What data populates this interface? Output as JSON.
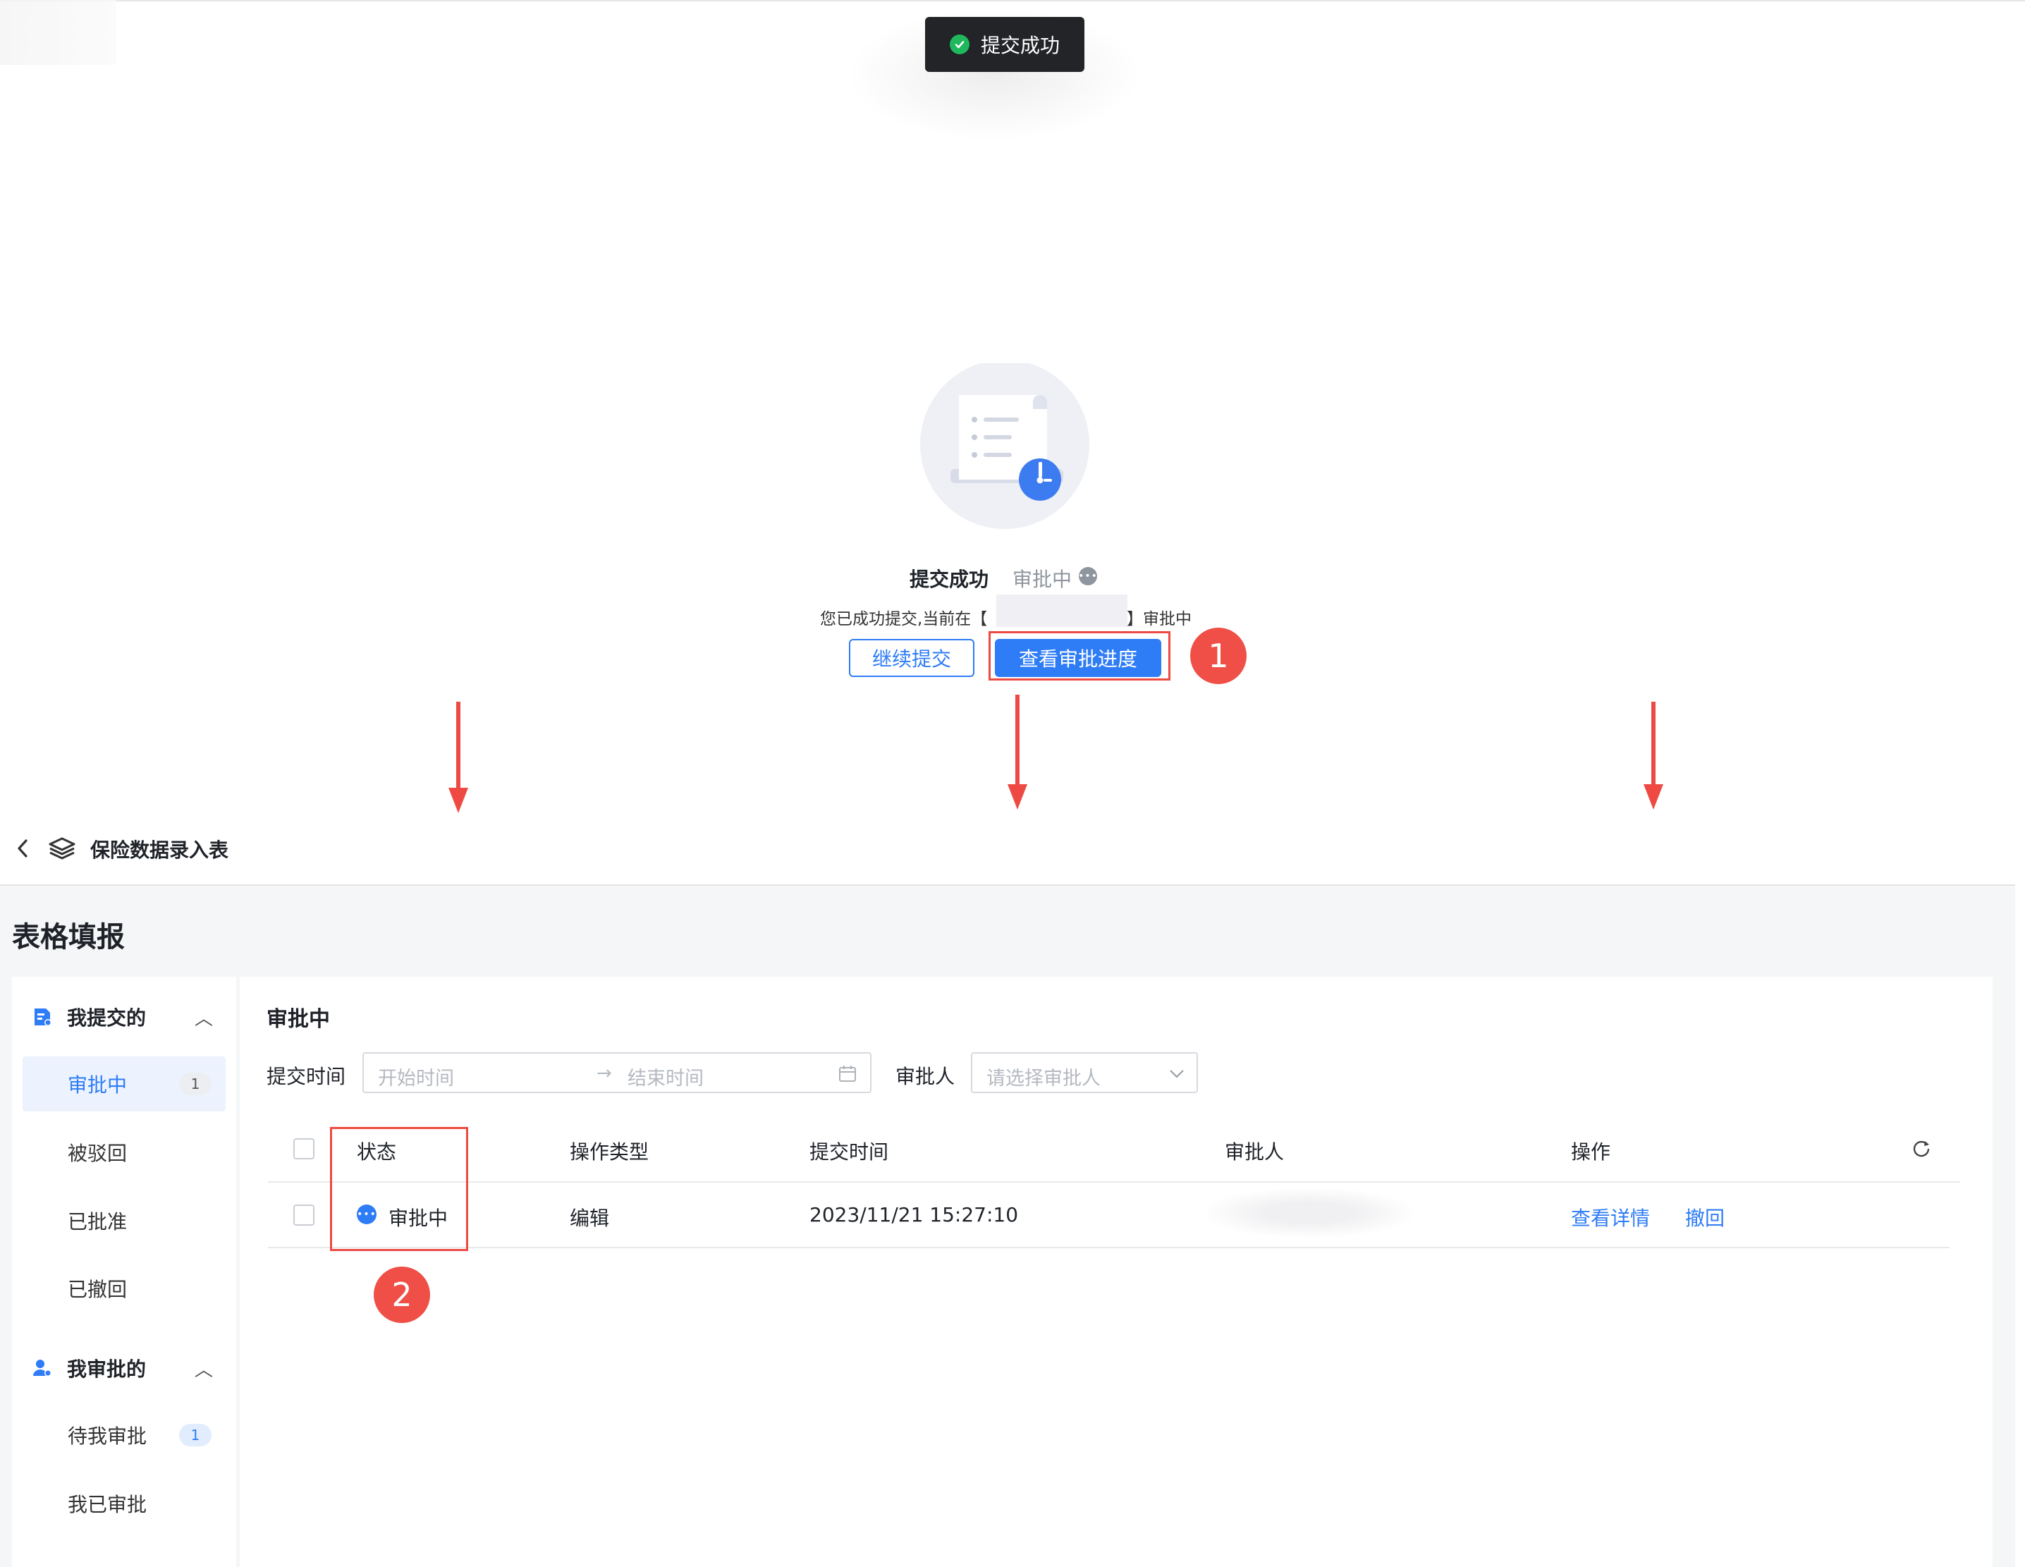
{
  "toast": {
    "icon": "check-circle-icon",
    "text": "提交成功"
  },
  "result": {
    "title": "提交成功",
    "status": "审批中",
    "desc_prefix": "您已成功提交,当前在【",
    "desc_suffix": "】审批中",
    "continue_label": "继续提交",
    "progress_label": "查看审批进度"
  },
  "annotations": {
    "step1": "1",
    "step2": "2"
  },
  "nav": {
    "back_icon": "chevron-left-icon",
    "app_icon": "layers-icon",
    "title": "保险数据录入表"
  },
  "page": {
    "title": "表格填报"
  },
  "sidebar": {
    "group1": {
      "icon": "submit-doc-icon",
      "label": "我提交的"
    },
    "group1_items": [
      {
        "label": "审批中",
        "count": "1"
      },
      {
        "label": "被驳回"
      },
      {
        "label": "已批准"
      },
      {
        "label": "已撤回"
      }
    ],
    "group2": {
      "icon": "approver-user-icon",
      "label": "我审批的"
    },
    "group2_items": [
      {
        "label": "待我审批",
        "count": "1"
      },
      {
        "label": "我已审批"
      }
    ]
  },
  "main": {
    "section_title": "审批中",
    "filters": {
      "time_label": "提交时间",
      "start_placeholder": "开始时间",
      "end_placeholder": "结束时间",
      "approver_label": "审批人",
      "approver_placeholder": "请选择审批人"
    },
    "table": {
      "headers": [
        "状态",
        "操作类型",
        "提交时间",
        "审批人",
        "操作"
      ],
      "rows": [
        {
          "status": "审批中",
          "op_type": "编辑",
          "submit_time": "2023/11/21 15:27:10",
          "approver": "",
          "actions": [
            "查看详情",
            "撤回"
          ]
        }
      ]
    }
  },
  "colors": {
    "accent": "#2e7cf6",
    "annotation_red": "#ee4a43",
    "success_green": "#1fb85c"
  }
}
